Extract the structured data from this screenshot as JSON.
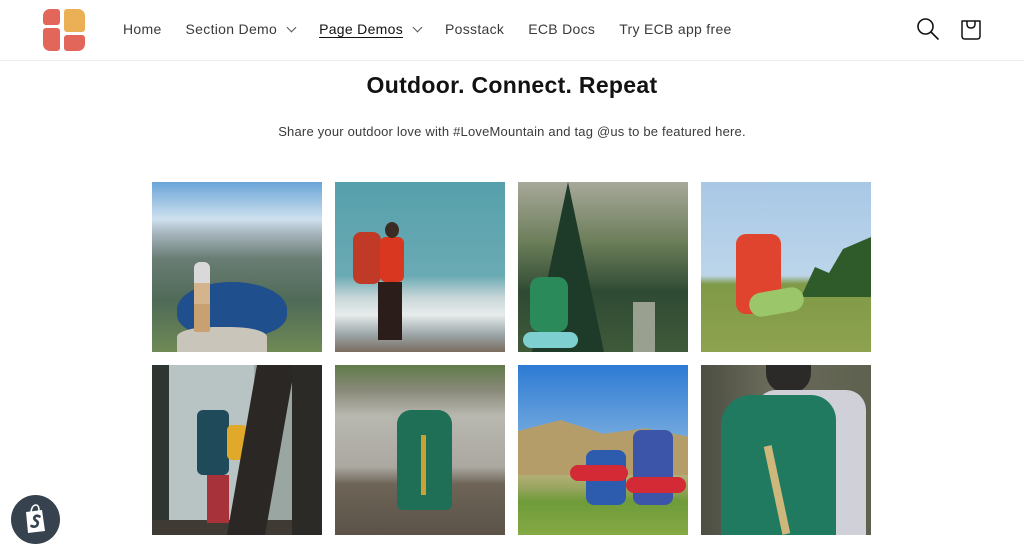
{
  "header": {
    "logo_alt": "Store logo",
    "nav": [
      {
        "label": "Home",
        "has_dropdown": false,
        "active": false
      },
      {
        "label": "Section Demo",
        "has_dropdown": true,
        "active": false
      },
      {
        "label": "Page Demos",
        "has_dropdown": true,
        "active": true
      },
      {
        "label": "Posstack",
        "has_dropdown": false,
        "active": false
      },
      {
        "label": "ECB Docs",
        "has_dropdown": false,
        "active": false
      },
      {
        "label": "Try ECB app free",
        "has_dropdown": false,
        "active": false
      }
    ],
    "icons": {
      "search": "search-icon",
      "cart": "cart-bag-icon"
    }
  },
  "main": {
    "title": "Outdoor. Connect. Repeat",
    "subtitle": "Share your outdoor love with #LoveMountain and tag @us to be featured here.",
    "gallery": [
      {
        "alt": "Hiker with backpack overlooking a fjord lake"
      },
      {
        "alt": "Hiker in red jacket with red backpack on mountain summit"
      },
      {
        "alt": "Hiker with green backpack and sleeping mat in pine forest"
      },
      {
        "alt": "Red backpack with green sleeping mat on grassy hill"
      },
      {
        "alt": "Hiker in yellow jacket leaning on tree in misty forest"
      },
      {
        "alt": "Green backpack sitting on rocky riverbank"
      },
      {
        "alt": "Two blue backpacks with red sleeping rolls on meadow"
      },
      {
        "alt": "Person wearing green backpack viewed from behind"
      }
    ]
  },
  "widgets": {
    "shopify_badge": "shopify-bag-icon"
  },
  "colors": {
    "logo_red": "#e2665a",
    "logo_yellow": "#ebaf56",
    "badge_bg": "#36424d",
    "text": "#121212"
  }
}
